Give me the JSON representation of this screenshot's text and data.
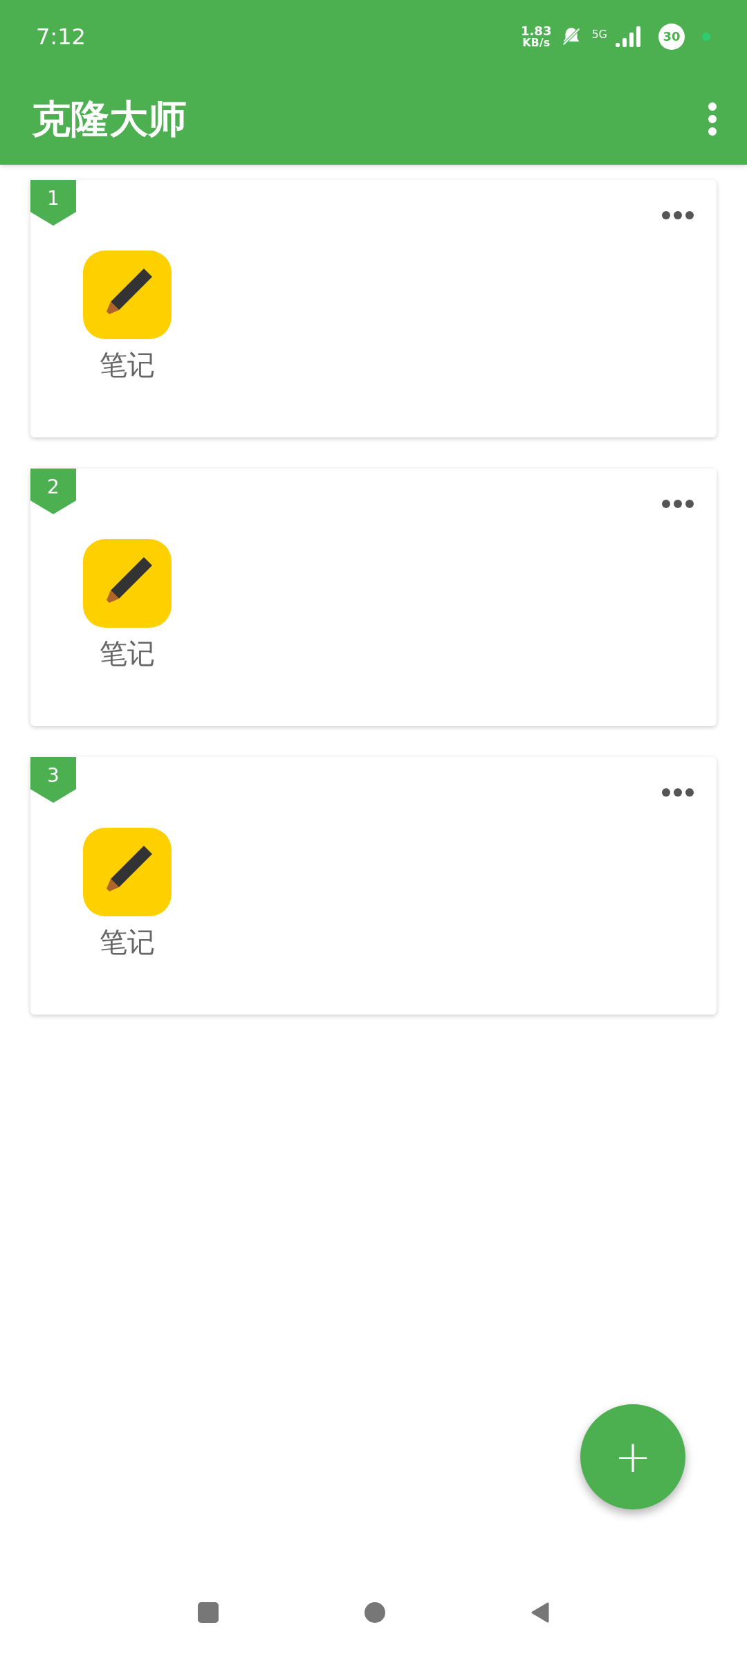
{
  "status_bar": {
    "time": "7:12",
    "speed_value": "1.83",
    "speed_unit": "KB/s",
    "network": "5G",
    "battery": "30"
  },
  "app_bar": {
    "title": "克隆大师"
  },
  "cards": [
    {
      "number": "1",
      "apps": [
        {
          "label": "笔记"
        }
      ]
    },
    {
      "number": "2",
      "apps": [
        {
          "label": "笔记"
        }
      ]
    },
    {
      "number": "3",
      "apps": [
        {
          "label": "笔记"
        }
      ]
    }
  ],
  "fab": {
    "label": "+"
  }
}
